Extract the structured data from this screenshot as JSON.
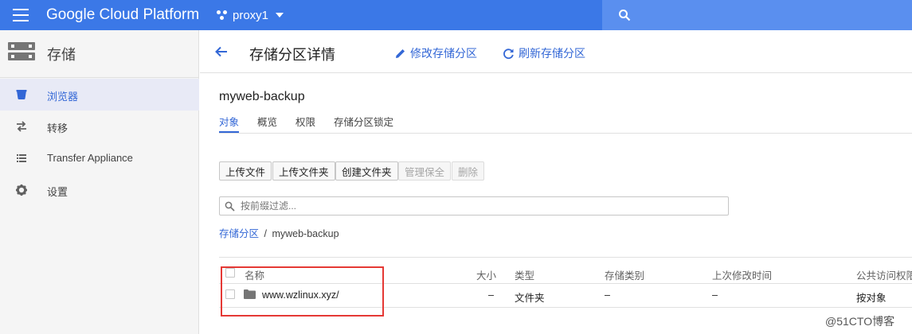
{
  "topbar": {
    "title": "Google Cloud Platform",
    "project": "proxy1",
    "accent": "#3b78e7"
  },
  "leftnav": {
    "title": "存储",
    "items": [
      {
        "label": "浏览器",
        "icon": "bucket-icon",
        "active": true
      },
      {
        "label": "转移",
        "icon": "transfer-arrows-icon"
      },
      {
        "label": "Transfer Appliance",
        "icon": "list-icon"
      },
      {
        "label": "设置",
        "icon": "gear-icon"
      }
    ]
  },
  "header": {
    "title": "存储分区详情",
    "edit": "修改存储分区",
    "refresh": "刷新存储分区"
  },
  "bucket": {
    "name": "myweb-backup",
    "tabs": [
      "对象",
      "概览",
      "权限",
      "存储分区锁定"
    ]
  },
  "toolbar": {
    "upload_files": "上传文件",
    "upload_folder": "上传文件夹",
    "create_folder": "创建文件夹",
    "manage_holds": "管理保全",
    "delete": "删除"
  },
  "filter": {
    "placeholder": "按前缀过滤..."
  },
  "breadcrumb": {
    "root": "存储分区",
    "separator": "/",
    "current": "myweb-backup"
  },
  "table": {
    "columns": [
      "名称",
      "大小",
      "类型",
      "存储类别",
      "上次修改时间",
      "公共访问权限"
    ],
    "rows": [
      {
        "name": "www.wzlinux.xyz/",
        "size": "–",
        "type": "文件夹",
        "storage_class": "–",
        "modified": "–",
        "public_access": "按对象"
      }
    ]
  },
  "watermark": "@51CTO博客"
}
